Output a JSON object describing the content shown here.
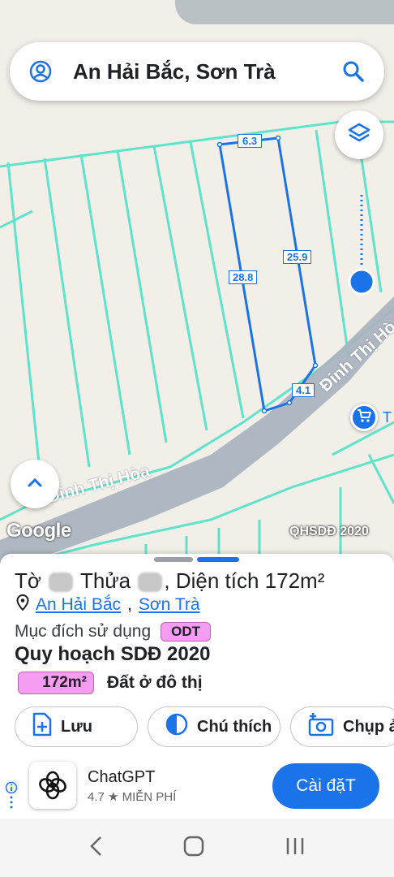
{
  "status_bar": {
    "time": "",
    "right_text": ""
  },
  "search": {
    "query": "An Hải Bắc, Sơn Trà"
  },
  "map": {
    "street_name_lower": "Đinh Thị Hòa",
    "street_name_upper": "Đinh Thị Hò",
    "dimensions": {
      "top": "6.3",
      "left": "28.8",
      "right": "25.9",
      "bottom": "4.1"
    },
    "google_label": "Google",
    "overlay_label": "QHSDĐ 2020",
    "shop_label": "T"
  },
  "parcel": {
    "title_prefix": "Tờ",
    "title_middle": "Thửa",
    "title_suffix": ", Diện tích 172m²",
    "ward": "An Hải Bắc",
    "district": "Sơn Trà",
    "purpose_label": "Mục đích sử dụng",
    "purpose_code": "ODT",
    "plan_title": "Quy hoạch SDĐ 2020",
    "area_value": "172m²",
    "area_label": "Đất ở đô thị"
  },
  "actions": {
    "save": "Lưu",
    "legend": "Chú thích",
    "capture": "Chụp ả"
  },
  "ad": {
    "app_name": "ChatGPT",
    "rating": "4.7 ★",
    "price": "MIỄN PHÍ",
    "install": "Cài đặT"
  },
  "colors": {
    "accent": "#1a73e8",
    "parcel_line": "#1a73e8",
    "plot_lines": "#5fe3cc",
    "road": "#a9b3be",
    "land_use_pink": "#f49df3"
  }
}
